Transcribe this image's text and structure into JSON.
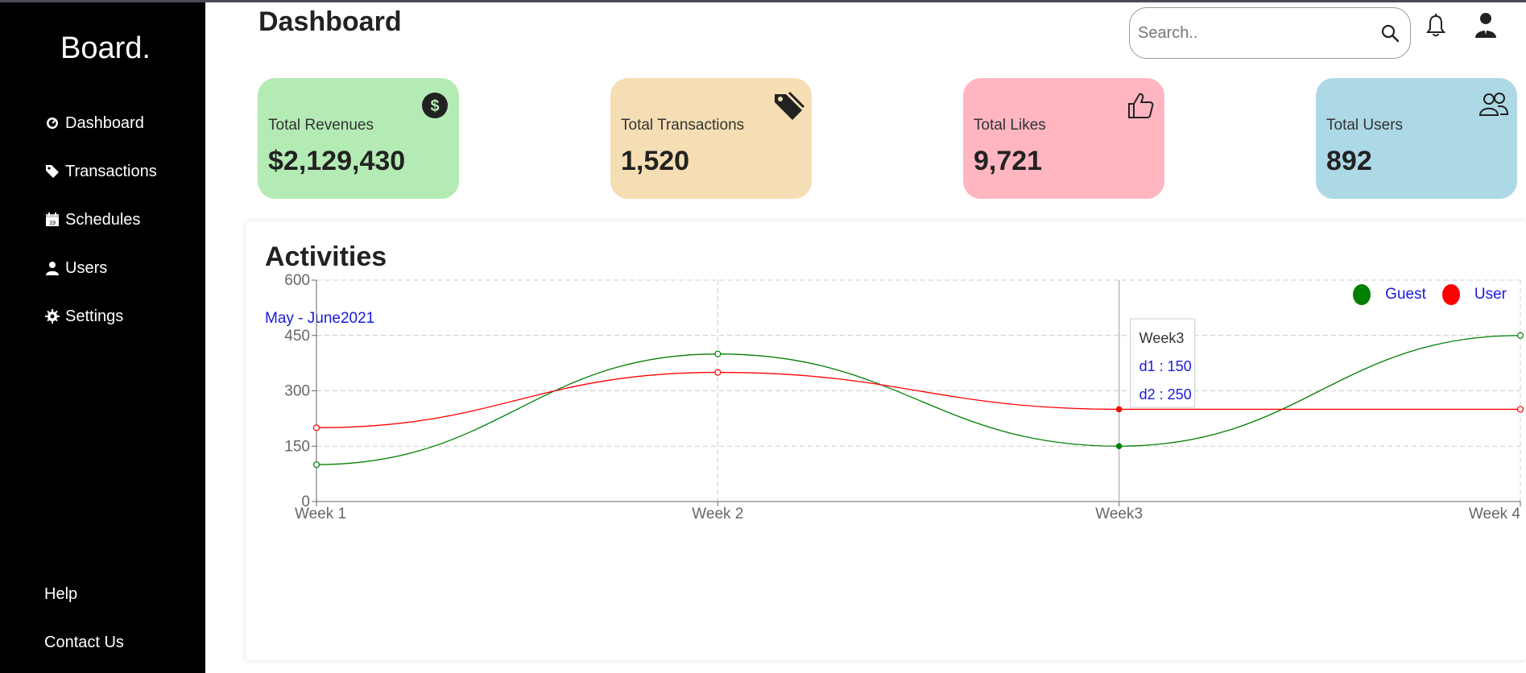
{
  "app": {
    "brand": "Board."
  },
  "sidebar": {
    "items": [
      {
        "label": "Dashboard",
        "icon": "gauge-icon"
      },
      {
        "label": "Transactions",
        "icon": "tag-icon"
      },
      {
        "label": "Schedules",
        "icon": "calendar-icon"
      },
      {
        "label": "Users",
        "icon": "user-icon"
      },
      {
        "label": "Settings",
        "icon": "gear-icon"
      }
    ],
    "footer": [
      {
        "label": "Help"
      },
      {
        "label": "Contact Us"
      }
    ]
  },
  "header": {
    "title": "Dashboard",
    "search_placeholder": "Search..",
    "search_value": ""
  },
  "cards": [
    {
      "label": "Total Revenues",
      "value": "$2,129,430",
      "color": "#b4ebb4",
      "icon": "dollar-icon"
    },
    {
      "label": "Total Transactions",
      "value": "1,520",
      "color": "#f5deb3",
      "icon": "tag-icon"
    },
    {
      "label": "Total Likes",
      "value": "9,721",
      "color": "#ffb6c1",
      "icon": "thumbs-up-icon"
    },
    {
      "label": "Total Users",
      "value": "892",
      "color": "#add8e6",
      "icon": "users-icon"
    }
  ],
  "activities": {
    "title": "Activities",
    "period": "May - June2021",
    "legend": [
      {
        "name": "Guest",
        "color": "#008000"
      },
      {
        "name": "User",
        "color": "#ff0000"
      }
    ]
  },
  "chart_data": {
    "type": "line",
    "categories": [
      "Week 1",
      "Week 2",
      "Week3",
      "Week 4"
    ],
    "series": [
      {
        "name": "Guest",
        "color": "#008000",
        "values": [
          100,
          400,
          150,
          450
        ]
      },
      {
        "name": "User",
        "color": "#ff0000",
        "values": [
          200,
          350,
          250,
          250
        ]
      }
    ],
    "yticks": [
      0,
      150,
      300,
      450,
      600
    ],
    "ylim": [
      0,
      600
    ],
    "grid": true,
    "legend_position": "top-right",
    "tooltip": {
      "title": "Week3",
      "line1": "d1 : 150",
      "line2": "d2 : 250"
    }
  }
}
